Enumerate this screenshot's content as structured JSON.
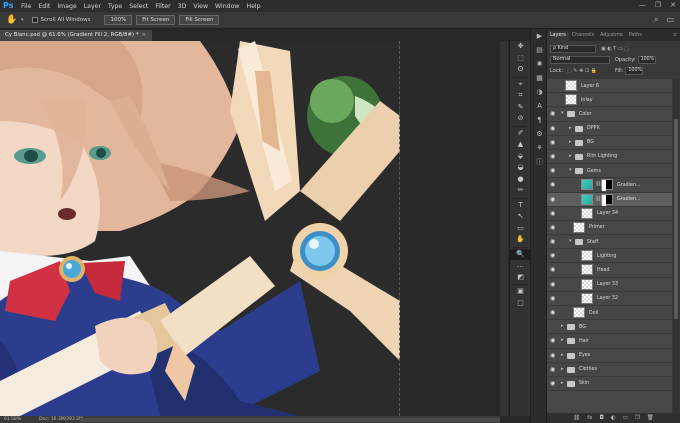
{
  "menubar": {
    "logo": "Ps",
    "items": [
      "File",
      "Edit",
      "Image",
      "Layer",
      "Type",
      "Select",
      "Filter",
      "3D",
      "View",
      "Window",
      "Help"
    ],
    "window_controls": [
      "—",
      "❐",
      "✕"
    ]
  },
  "options_bar": {
    "scroll_all_label": "Scroll All Windows",
    "zoom_button": "100%",
    "fit_button": "Fit Screen",
    "fill_button": "Fill Screen"
  },
  "document_tab": {
    "title": "Cy Blanc.psd @ 61.6% (Gradient Fill 2, RGB/8#) *",
    "close": "×"
  },
  "status_bar": {
    "zoom": "61.58%",
    "doc": "Doc: 16.3M/393.2M"
  },
  "tools": [
    "✥",
    "⬚",
    "ʘ",
    "⌖",
    "⌗",
    "✎",
    "⊘",
    "✐",
    "▲",
    "⬙",
    "◒",
    "●",
    "✏",
    "T",
    "↖",
    "▭",
    "✋",
    "🔍",
    "…",
    "◩",
    "▣",
    "▢"
  ],
  "layers_panel": {
    "tabs": [
      "Layers",
      "Channels",
      "Adjustme",
      "Paths"
    ],
    "active_tab": "Layers",
    "kind_filter": "ρ Kind",
    "blend_mode": "Normal",
    "opacity_label": "Opacity:",
    "opacity_value": "100%",
    "lock_label": "Lock:",
    "fill_label": "Fill:",
    "fill_value": "100%",
    "layers": [
      {
        "name": "Layer 6",
        "visible": false,
        "indent": 0,
        "kind": "pixel"
      },
      {
        "name": "Inlay",
        "visible": false,
        "indent": 0,
        "kind": "pixel"
      },
      {
        "name": "Color",
        "visible": true,
        "indent": 0,
        "kind": "group",
        "open": true
      },
      {
        "name": "DPPX",
        "visible": true,
        "indent": 1,
        "kind": "group",
        "open": false
      },
      {
        "name": "BG",
        "visible": true,
        "indent": 1,
        "kind": "group",
        "open": false
      },
      {
        "name": "Rim Lighting",
        "visible": true,
        "indent": 1,
        "kind": "group",
        "open": false
      },
      {
        "name": "Gems",
        "visible": true,
        "indent": 1,
        "kind": "group",
        "open": true
      },
      {
        "name": "Gradien...",
        "visible": true,
        "indent": 2,
        "kind": "adjust",
        "selected": false
      },
      {
        "name": "Gradien...",
        "visible": true,
        "indent": 2,
        "kind": "adjust",
        "selected": true
      },
      {
        "name": "Layer 34",
        "visible": true,
        "indent": 2,
        "kind": "pixel"
      },
      {
        "name": "Primer",
        "visible": true,
        "indent": 1,
        "kind": "pixel"
      },
      {
        "name": "Staff",
        "visible": true,
        "indent": 1,
        "kind": "group",
        "open": true
      },
      {
        "name": "Lighting",
        "visible": true,
        "indent": 2,
        "kind": "pixel"
      },
      {
        "name": "Head",
        "visible": true,
        "indent": 2,
        "kind": "pixel"
      },
      {
        "name": "Layer 33",
        "visible": true,
        "indent": 2,
        "kind": "pixel"
      },
      {
        "name": "Layer 32",
        "visible": true,
        "indent": 2,
        "kind": "pixel"
      },
      {
        "name": "Doll",
        "visible": true,
        "indent": 1,
        "kind": "pixel"
      },
      {
        "name": "BG",
        "visible": false,
        "indent": 0,
        "kind": "group",
        "open": false
      },
      {
        "name": "Hair",
        "visible": true,
        "indent": 0,
        "kind": "group",
        "open": false
      },
      {
        "name": "Eyes",
        "visible": true,
        "indent": 0,
        "kind": "group",
        "open": false
      },
      {
        "name": "Clothes",
        "visible": true,
        "indent": 0,
        "kind": "group",
        "open": false
      },
      {
        "name": "Skin",
        "visible": true,
        "indent": 0,
        "kind": "group",
        "open": false
      }
    ],
    "bottom_icons": [
      "⛓",
      "fx",
      "◘",
      "◐",
      "▭",
      "❐",
      "🗑"
    ]
  }
}
